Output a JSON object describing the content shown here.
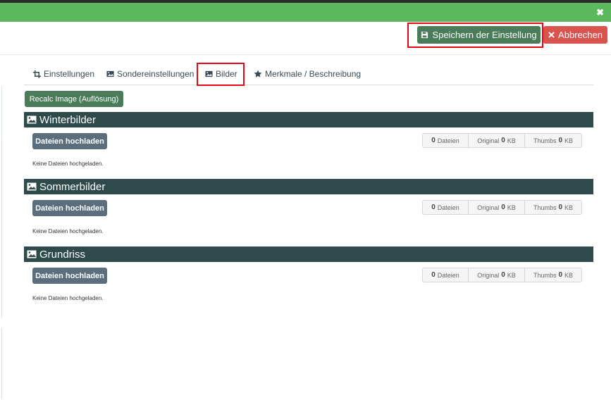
{
  "toolbar": {
    "save_label": "Speichern der Einstellung",
    "cancel_label": "Abbrechen",
    "close_glyph": "✖"
  },
  "tabs": [
    {
      "label": "Einstellungen",
      "icon": "crop-icon"
    },
    {
      "label": "Sondereinstellungen",
      "icon": "image-icon"
    },
    {
      "label": "Bilder",
      "icon": "image-icon",
      "active": true
    },
    {
      "label": "Merkmale / Beschreibung",
      "icon": "star-icon"
    }
  ],
  "recalc_label": "Recalc Image (Auflösung)",
  "sections": [
    {
      "title": "Winterbilder",
      "upload_label": "Dateien hochladen",
      "files_count": "0",
      "files_label": "Dateien",
      "original_label": "Original",
      "original_value": "0",
      "original_unit": "KB",
      "thumbs_label": "Thumbs",
      "thumbs_value": "0",
      "thumbs_unit": "KB",
      "empty_text": "Keine Dateien hochgeladen."
    },
    {
      "title": "Sommerbilder",
      "upload_label": "Dateien hochladen",
      "files_count": "0",
      "files_label": "Dateien",
      "original_label": "Original",
      "original_value": "0",
      "original_unit": "KB",
      "thumbs_label": "Thumbs",
      "thumbs_value": "0",
      "thumbs_unit": "KB",
      "empty_text": "Keine Dateien hochgeladen."
    },
    {
      "title": "Grundriss",
      "upload_label": "Dateien hochladen",
      "files_count": "0",
      "files_label": "Dateien",
      "original_label": "Original",
      "original_value": "0",
      "original_unit": "KB",
      "thumbs_label": "Thumbs",
      "thumbs_value": "0",
      "thumbs_unit": "KB",
      "empty_text": "Keine Dateien hochgeladen."
    }
  ],
  "colors": {
    "header_green": "#5cb85c",
    "save_green": "#4a7c59",
    "cancel_red": "#d9534f",
    "section_dark": "#2e4a4a",
    "highlight_red": "#e30613"
  }
}
